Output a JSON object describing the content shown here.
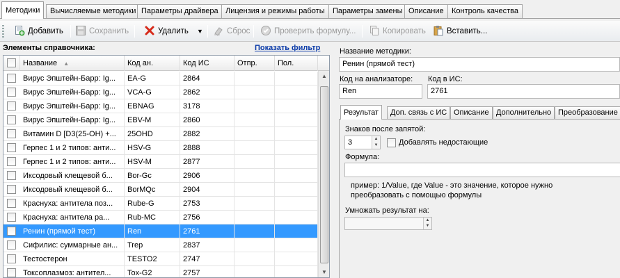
{
  "tabs": [
    {
      "label": "Методики",
      "active": true
    },
    {
      "label": "Вычисляемые методики"
    },
    {
      "label": "Параметры драйвера"
    },
    {
      "label": "Лицензия и режимы работы"
    },
    {
      "label": "Параметры замены"
    },
    {
      "label": "Описание"
    },
    {
      "label": "Контроль качества"
    }
  ],
  "toolbar": {
    "add": "Добавить",
    "save": "Сохранить",
    "delete": "Удалить",
    "reset": "Сброс",
    "check_formula": "Проверить формулу...",
    "copy": "Копировать",
    "paste": "Вставить..."
  },
  "left": {
    "title": "Элементы справочника:",
    "filter_link": "Показать фильтр"
  },
  "grid": {
    "columns": [
      "Название",
      "Код ан.",
      "Код ИС",
      "Отпр.",
      "Пол."
    ],
    "rows": [
      {
        "name": "Вирус Эпштейн-Барр: Ig...",
        "code_an": "EA-G",
        "code_is": "2864",
        "selected": false
      },
      {
        "name": "Вирус Эпштейн-Барр: Ig...",
        "code_an": "VCA-G",
        "code_is": "2862",
        "selected": false
      },
      {
        "name": "Вирус Эпштейн-Барр: Ig...",
        "code_an": "EBNAG",
        "code_is": "3178",
        "selected": false
      },
      {
        "name": "Вирус Эпштейн-Барр: Ig...",
        "code_an": "EBV-M",
        "code_is": "2860",
        "selected": false
      },
      {
        "name": "Витамин D [D3(25-OH) +...",
        "code_an": "25OHD",
        "code_is": "2882",
        "selected": false
      },
      {
        "name": "Герпес 1 и 2 типов: анти...",
        "code_an": "HSV-G",
        "code_is": "2888",
        "selected": false
      },
      {
        "name": "Герпес 1 и 2 типов: анти...",
        "code_an": "HSV-M",
        "code_is": "2877",
        "selected": false
      },
      {
        "name": "Иксодовый клещевой б...",
        "code_an": "Bor-Gc",
        "code_is": "2906",
        "selected": false
      },
      {
        "name": "Иксодовый клещевой б...",
        "code_an": "BorMQc",
        "code_is": "2904",
        "selected": false
      },
      {
        "name": "Краснуха: антитела поз...",
        "code_an": "Rube-G",
        "code_is": "2753",
        "selected": false
      },
      {
        "name": "Краснуха: антитела ра...",
        "code_an": "Rub-MC",
        "code_is": "2756",
        "selected": false
      },
      {
        "name": "Ренин (прямой тест)",
        "code_an": "Ren",
        "code_is": "2761",
        "selected": true
      },
      {
        "name": "Сифилис: суммарные ан...",
        "code_an": "Trep",
        "code_is": "2837",
        "selected": false
      },
      {
        "name": "Тестостерон",
        "code_an": "TESTO2",
        "code_is": "2747",
        "selected": false
      },
      {
        "name": "Токсоплазмоз: антител...",
        "code_an": "Tox-G2",
        "code_is": "2757",
        "selected": false
      }
    ]
  },
  "details": {
    "method_name_label": "Название методики:",
    "method_name_value": "Ренин (прямой тест)",
    "analyzer_code_label": "Код на анализаторе:",
    "analyzer_code_value": "Ren",
    "is_code_label": "Код в ИС:",
    "is_code_value": "2761",
    "tabs": [
      "Результат",
      "Доп. связь с ИС",
      "Описание",
      "Дополнительно",
      "Преобразование"
    ],
    "decimals_label": "Знаков после запятой:",
    "decimals_value": "3",
    "add_missing_label": "Добавлять недостающие",
    "formula_label": "Формула:",
    "formula_value": "",
    "formula_note": "пример: 1/Value, где Value - это значение, которое нужно преобразовать с помощью формулы",
    "multiply_label": "Умножать результат на:",
    "multiply_value": ""
  }
}
